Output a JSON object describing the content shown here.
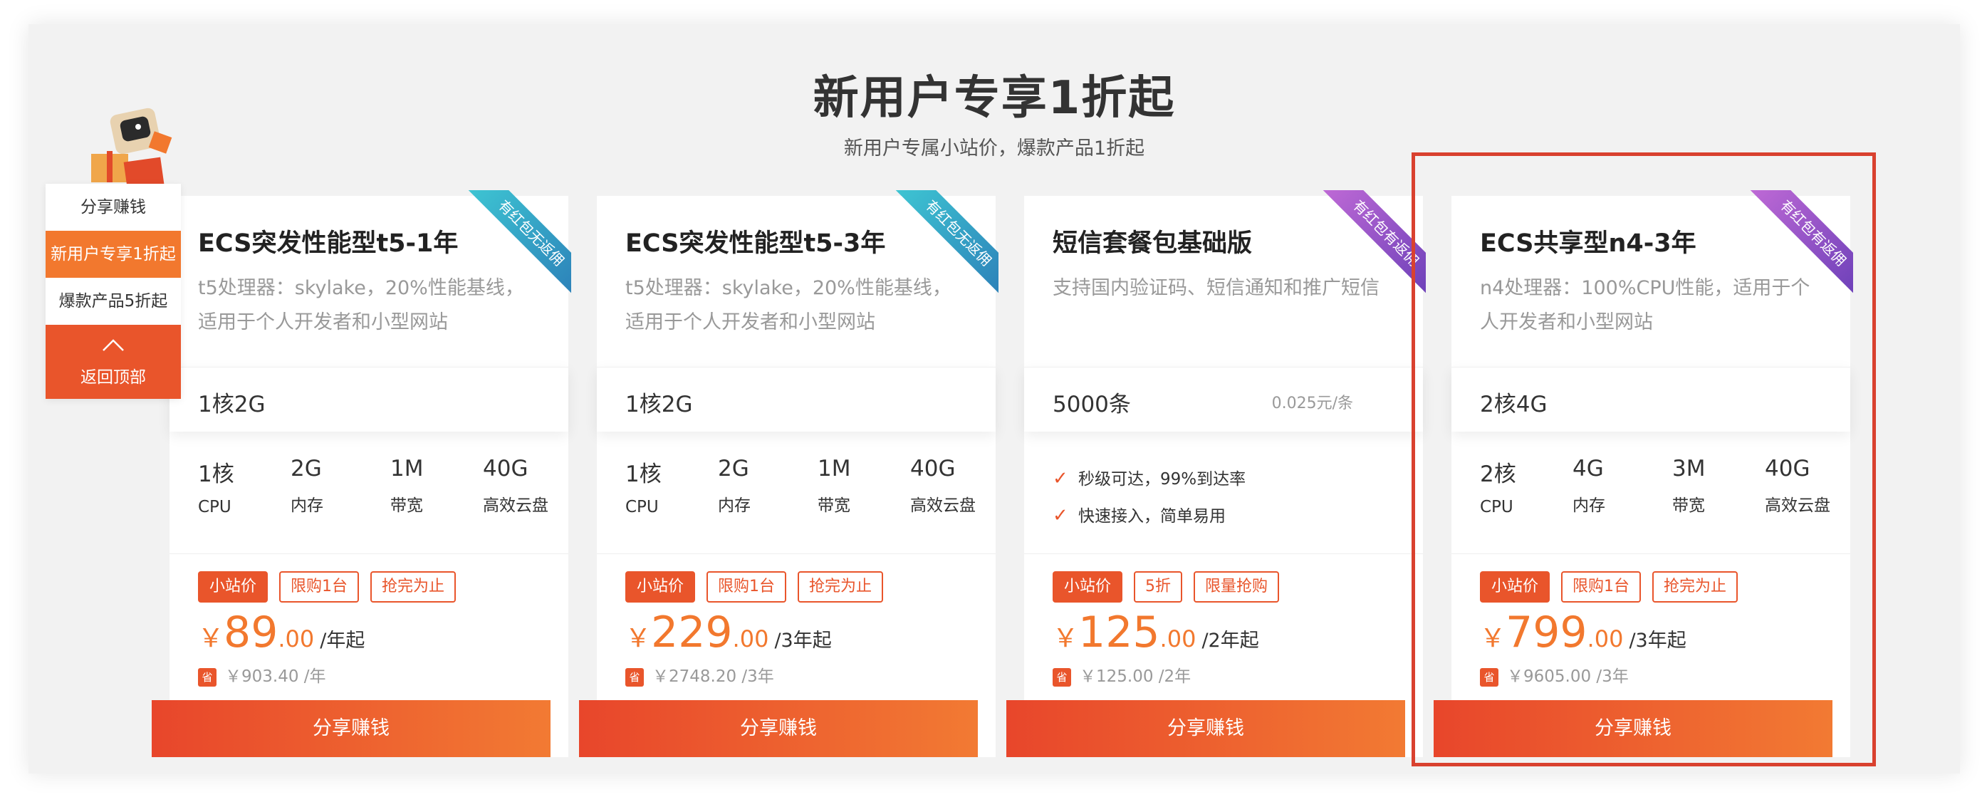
{
  "header": {
    "title": "新用户专享1折起",
    "subtitle": "新用户专属小站价，爆款产品1折起"
  },
  "side_nav": {
    "items": [
      "分享赚钱",
      "新用户专享1折起",
      "爆款产品5折起"
    ],
    "active_index": 1,
    "back_top_label": "返回顶部"
  },
  "cards": [
    {
      "name": "ECS突发性能型t5-1年",
      "description": "t5处理器：skylake，20%性能基线，适用于个人开发者和小型网站",
      "ribbon": "有红包无返佣",
      "spec": "1核2G",
      "attrs": [
        {
          "value": "1核",
          "label": "CPU"
        },
        {
          "value": "2G",
          "label": "内存"
        },
        {
          "value": "1M",
          "label": "带宽"
        },
        {
          "value": "40G",
          "label": "高效云盘"
        }
      ],
      "tags": [
        "小站价",
        "限购1台",
        "抢完为止"
      ],
      "price_currency": "￥",
      "price_int": "89",
      "price_dec": ".00",
      "price_unit": "/年起",
      "save_badge": "省",
      "save_text": "￥903.40 /年",
      "button": "分享赚钱"
    },
    {
      "name": "ECS突发性能型t5-3年",
      "description": "t5处理器：skylake，20%性能基线，适用于个人开发者和小型网站",
      "ribbon": "有红包无返佣",
      "spec": "1核2G",
      "attrs": [
        {
          "value": "1核",
          "label": "CPU"
        },
        {
          "value": "2G",
          "label": "内存"
        },
        {
          "value": "1M",
          "label": "带宽"
        },
        {
          "value": "40G",
          "label": "高效云盘"
        }
      ],
      "tags": [
        "小站价",
        "限购1台",
        "抢完为止"
      ],
      "price_currency": "￥",
      "price_int": "229",
      "price_dec": ".00",
      "price_unit": "/3年起",
      "save_badge": "省",
      "save_text": "￥2748.20 /3年",
      "button": "分享赚钱"
    },
    {
      "name": "短信套餐包基础版",
      "description": "支持国内验证码、短信通知和推广短信",
      "ribbon": "有红包有返佣",
      "spec": "5000条",
      "spec_price": "0.025元/条",
      "features": [
        "秒级可达，99%到达率",
        "快速接入，简单易用"
      ],
      "tags": [
        "小站价",
        "5折",
        "限量抢购"
      ],
      "price_currency": "￥",
      "price_int": "125",
      "price_dec": ".00",
      "price_unit": "/2年起",
      "save_badge": "省",
      "save_text": "￥125.00 /2年",
      "button": "分享赚钱"
    },
    {
      "name": "ECS共享型n4-3年",
      "description": "n4处理器：100%CPU性能，适用于个人开发者和小型网站",
      "ribbon": "有红包有返佣",
      "spec": "2核4G",
      "attrs": [
        {
          "value": "2核",
          "label": "CPU"
        },
        {
          "value": "4G",
          "label": "内存"
        },
        {
          "value": "3M",
          "label": "带宽"
        },
        {
          "value": "40G",
          "label": "高效云盘"
        }
      ],
      "tags": [
        "小站价",
        "限购1台",
        "抢完为止"
      ],
      "price_currency": "￥",
      "price_int": "799",
      "price_dec": ".00",
      "price_unit": "/3年起",
      "save_badge": "省",
      "save_text": "￥9605.00 /3年",
      "button": "分享赚钱"
    }
  ],
  "colors": {
    "accent": "#e9552b",
    "price": "#f2782e",
    "highlight_border": "#d9412f",
    "ribbon_teal": "#2c9fc4",
    "ribbon_purple": "#8a4fc8"
  }
}
